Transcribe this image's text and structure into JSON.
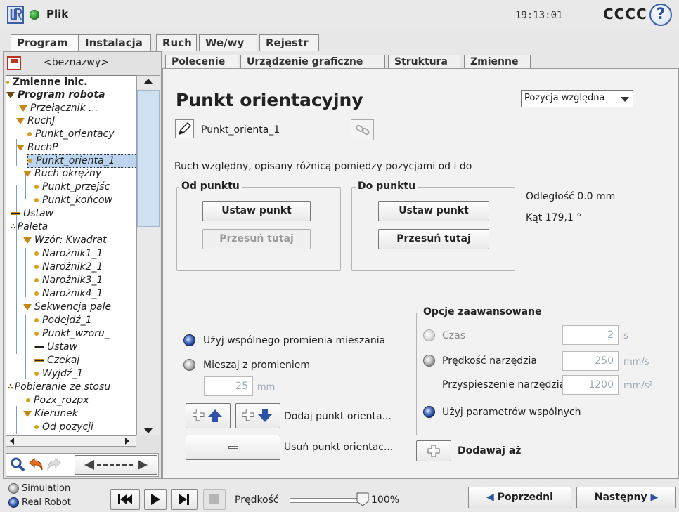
{
  "topbar": {
    "menu_label": "Plik",
    "clock": "19:13:01",
    "robot_name": "CCCC",
    "help_glyph": "?"
  },
  "main_tabs": [
    {
      "label": "Program"
    },
    {
      "label": "Instalacja"
    },
    {
      "label": "Ruch"
    },
    {
      "label": "We/wy"
    },
    {
      "label": "Rejestr"
    }
  ],
  "left": {
    "program_name": "<beznazwy>",
    "tree": [
      {
        "label": "Zmienne inic."
      },
      {
        "label": "Program robota"
      },
      {
        "label": "Przełącznik ..."
      },
      {
        "label": "RuchJ"
      },
      {
        "label": "Punkt_orientacy"
      },
      {
        "label": "RuchP"
      },
      {
        "label": "Punkt_orienta_1"
      },
      {
        "label": "Ruch okrężny"
      },
      {
        "label": "Punkt_przejśc"
      },
      {
        "label": "Punkt_końcow"
      },
      {
        "label": "Ustaw"
      },
      {
        "label": "Paleta"
      },
      {
        "label": "Wzór: Kwadrat"
      },
      {
        "label": "Narożnik1_1"
      },
      {
        "label": "Narożnik2_1"
      },
      {
        "label": "Narożnik3_1"
      },
      {
        "label": "Narożnik4_1"
      },
      {
        "label": "Sekwencja pale"
      },
      {
        "label": "Podejdź_1"
      },
      {
        "label": "Punkt_wzoru_"
      },
      {
        "label": "Ustaw"
      },
      {
        "label": "Czekaj"
      },
      {
        "label": "Wyjdź_1"
      },
      {
        "label": "Pobieranie ze stosu"
      },
      {
        "label": "Pozx_rozpx"
      },
      {
        "label": "Kierunek"
      },
      {
        "label": "Od pozycji"
      }
    ]
  },
  "content_tabs": [
    {
      "label": "Polecenie"
    },
    {
      "label": "Urządzenie graficzne"
    },
    {
      "label": "Struktura"
    },
    {
      "label": "Zmienne"
    }
  ],
  "command": {
    "title": "Punkt orientacyjny",
    "position_mode": "Pozycja względna",
    "waypoint_name": "Punkt_orienta_1",
    "description": "Ruch względny, opisany różnicą pomiędzy pozycjami od i do",
    "from_group": {
      "legend": "Od punktu",
      "set_button": "Ustaw punkt",
      "move_button": "Przesuń tutaj"
    },
    "to_group": {
      "legend": "Do punktu",
      "set_button": "Ustaw punkt",
      "move_button": "Przesuń tutaj"
    },
    "distance": "Odległość 0.0 mm",
    "angle": "Kąt 179,1 °",
    "blend": {
      "shared_label": "Użyj wspólnego promienia mieszania",
      "radius_label": "Mieszaj z promieniem",
      "radius_value": "25",
      "radius_unit": "mm"
    },
    "add_waypoint_label": "Dodaj punkt orienta...",
    "remove_waypoint_label": "Usuń punkt orientac...",
    "advanced": {
      "legend": "Opcje zaawansowane",
      "time_label": "Czas",
      "time_value": "2",
      "time_unit": "s",
      "tool_speed_label": "Prędkość narzędzia",
      "tool_speed_value": "250",
      "tool_speed_unit": "mm/s",
      "tool_accel_label": "Przyspieszenie narzędzia",
      "tool_accel_value": "1200",
      "tool_accel_unit": "mm/s²",
      "shared_params_label": "Użyj parametrów wspólnych"
    },
    "add_until_label": "Dodawaj aż"
  },
  "bottom": {
    "simulation_label": "Simulation",
    "real_robot_label": "Real Robot",
    "speed_label": "Prędkość",
    "speed_value": "100%",
    "speed_fraction": 1.0,
    "prev_label": "Poprzedni",
    "next_label": "Następny"
  },
  "colors": {
    "accent_blue": "#2d52a8",
    "selection": "#bcd4ee",
    "node_gold": "#c28a14"
  }
}
